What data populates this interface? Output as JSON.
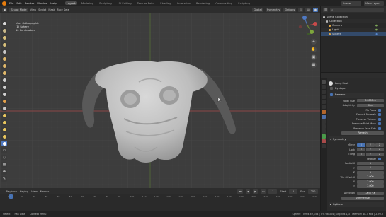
{
  "menu": {
    "items": [
      "File",
      "Edit",
      "Render",
      "Window",
      "Help"
    ],
    "workspaces": [
      "Layout",
      "Modeling",
      "Sculpting",
      "UV Editing",
      "Texture Paint",
      "Shading",
      "Animation",
      "Rendering",
      "Compositing",
      "Scripting"
    ],
    "active_workspace": "Layout",
    "scene": "Scene",
    "view_layer": "View Layer"
  },
  "viewport_header": {
    "mode": "Sculpt Mode",
    "menus": [
      "View",
      "Sculpt",
      "Mask",
      "Face Sets"
    ],
    "transform": "Global",
    "symmetry": "Symmetry",
    "options": "Options"
  },
  "viewport_overlay": {
    "line1": "User Orthographic",
    "line2": "(1) Sphere",
    "line3": "10 Centimeters"
  },
  "timeline": {
    "menus": [
      "Playback",
      "Keying",
      "View",
      "Marker"
    ],
    "ticks": [
      "0",
      "10",
      "20",
      "30",
      "40",
      "50",
      "60",
      "70",
      "80",
      "90",
      "100",
      "110",
      "120",
      "130",
      "140",
      "150",
      "160",
      "170",
      "180",
      "190",
      "200",
      "210",
      "220",
      "230",
      "240",
      "250"
    ],
    "current_frame": "1",
    "start_label": "Start",
    "start": "1",
    "end_label": "End",
    "end": "250"
  },
  "status_bar": {
    "left": "Select",
    "middle1": "Pan View",
    "middle2": "Context Menu",
    "right": "Sphere | Verts 49,154 | Tris 98,304 | Objects 1/3 | Memory 48.3 MiB | 2.90.0"
  },
  "outliner": {
    "title": "Scene Collection",
    "rows": [
      {
        "label": "Scene Collection",
        "color": "#bbbbbb"
      },
      {
        "label": "Collection",
        "color": "#bbbbbb"
      },
      {
        "label": "Camera",
        "color": "#d9a44a"
      },
      {
        "label": "Light",
        "color": "#d9a44a"
      },
      {
        "label": "Sphere",
        "color": "#d9a44a"
      }
    ]
  },
  "properties": {
    "brush_name": "Lamp Mask",
    "rows": [
      {
        "label": "Radius",
        "value": "0.200 m"
      },
      {
        "label": "Strength",
        "value": "0.500"
      }
    ],
    "checks": [
      {
        "label": "Dyntopo",
        "on": false
      },
      {
        "label": "Remesh",
        "on": true
      }
    ],
    "remesh": {
      "voxel_size_label": "Voxel Size",
      "voxel_size": "0.0050 m",
      "adaptivity_label": "Adaptivity",
      "adaptivity": "0 m",
      "toggles": [
        {
          "label": "Fix Poles",
          "on": true
        },
        {
          "label": "Smooth Normals",
          "on": true
        },
        {
          "label": "Preserve Volume",
          "on": true
        },
        {
          "label": "Preserve Paint Mask",
          "on": true
        },
        {
          "label": "Preserve Face Sets",
          "on": true
        }
      ],
      "button": "Remesh"
    },
    "symmetry": {
      "title": "Symmetry",
      "mirror_label": "Mirror",
      "lock_label": "Lock",
      "tiling_label": "Tiling",
      "axes": [
        "X",
        "Y",
        "Z"
      ],
      "feather_label": "Feather",
      "radial_label": "Radial X",
      "radial": [
        "1",
        "1",
        "1"
      ],
      "tile_offset_label": "Tile Offset X",
      "tile_offset": [
        "2.000",
        "2.000",
        "2.000"
      ],
      "symmetrize_label": "Direction",
      "symmetrize_value": "-X to +X",
      "symmetrize_button": "Symmetrize"
    },
    "options": "Options"
  },
  "colors": {
    "accent": "#4772b3",
    "axis_x": "#a64a4a",
    "axis_y": "#6f9431",
    "mesh": "#c8c8c8",
    "horn": "#5a5a5a"
  }
}
